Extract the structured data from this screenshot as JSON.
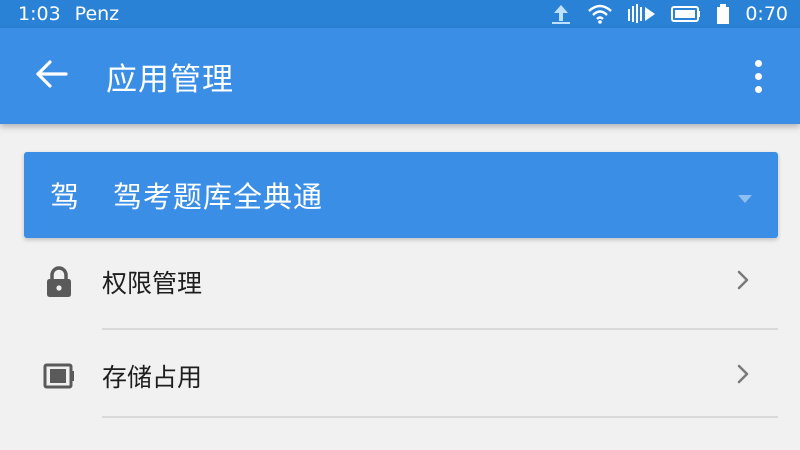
{
  "status_bar": {
    "time": "1:03",
    "carrier": "Penz",
    "battery_text": "0:70",
    "icons": [
      "upload-icon",
      "wifi-icon",
      "signal-icon",
      "battery-icon",
      "sim-icon"
    ]
  },
  "app_bar": {
    "title": "应用管理",
    "back_icon": "arrow-back-icon",
    "more_icon": "more-vert-icon"
  },
  "app_selector": {
    "glyph": "驾",
    "name": "驾考题库全典通",
    "caret_icon": "dropdown-caret-icon"
  },
  "menu": [
    {
      "label": "权限管理",
      "icon": "lock-icon"
    },
    {
      "label": "存储占用",
      "icon": "storage-icon"
    }
  ],
  "colors": {
    "primary": "#3a8ee6",
    "status_bar": "#2a82d6",
    "background": "#f1f1f1",
    "text": "#1e1e1e",
    "icon_gray": "#5a5a5a"
  }
}
